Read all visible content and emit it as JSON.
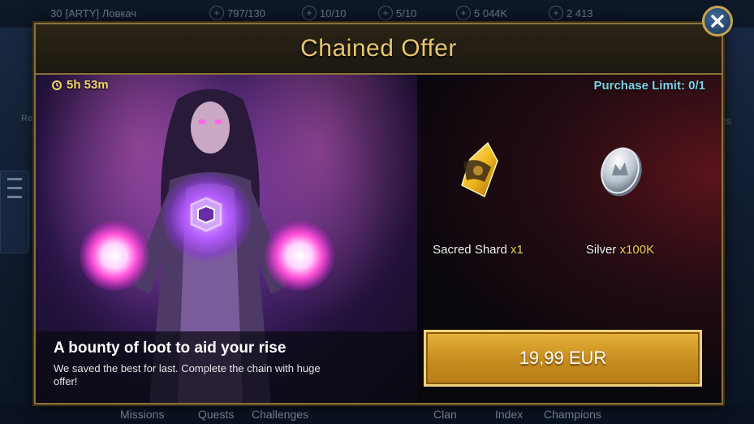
{
  "background": {
    "player_name": "[ARTY] Ловкач",
    "player_level": "30",
    "resources": [
      {
        "value": "797/130"
      },
      {
        "value": "10/10"
      },
      {
        "value": "5/10"
      },
      {
        "value": "5 044K"
      },
      {
        "value": "2 413"
      }
    ],
    "side_labels": {
      "left": "Re Pr",
      "right": "ts"
    },
    "nav": [
      "Missions",
      "Quests",
      "Challenges",
      "Clan",
      "Index",
      "Champions"
    ]
  },
  "modal": {
    "title": "Chained Offer",
    "timer": "5h 53m",
    "purchase_limit": "Purchase Limit: 0/1",
    "rewards": [
      {
        "name": "Sacred Shard",
        "qty": "x1",
        "icon": "sacred-shard-icon"
      },
      {
        "name": "Silver",
        "qty": "x100K",
        "icon": "silver-coin-icon"
      }
    ],
    "offer_title": "A bounty of loot to aid your rise",
    "offer_desc": "We saved the best for last. Complete the chain with huge offer!",
    "price": "19,99 EUR",
    "colors": {
      "gold": "#e6c66e",
      "button": "#d9a22e",
      "limit": "#7fd0e6",
      "qty": "#f2cf4e"
    }
  }
}
